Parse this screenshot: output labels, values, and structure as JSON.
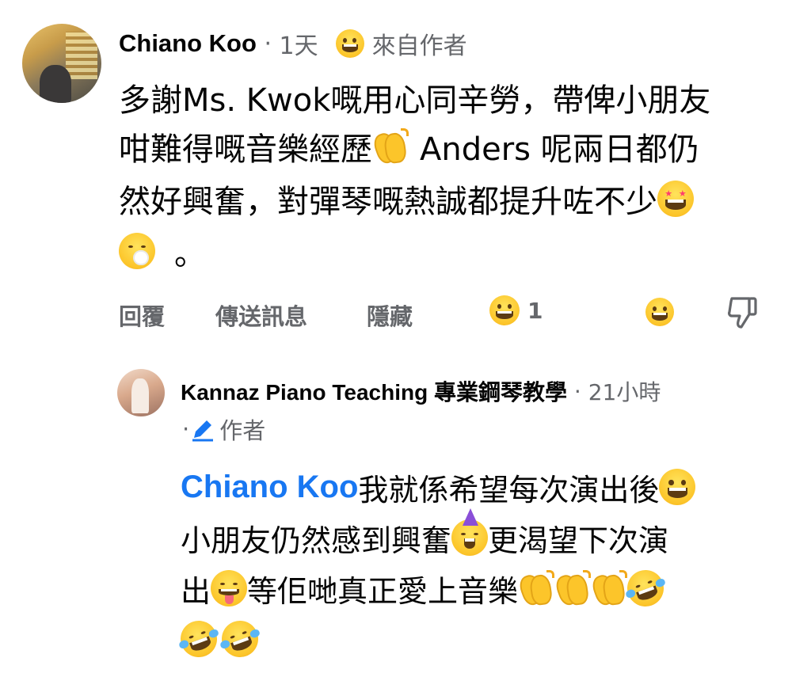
{
  "comment": {
    "author": "Chiano Koo",
    "time": "1天",
    "badge": "來自作者",
    "body_lines": [
      "多謝Ms. Kwok嘅用心同辛勞，帶俾小朋友",
      "咁難得嘅音樂經歷",
      " Anders 呢兩日都仍",
      "然好興奮，對彈琴嘅熱誠都提升咗不少",
      "。"
    ],
    "actions": {
      "reply": "回覆",
      "send_message": "傳送訊息",
      "hide": "隱藏"
    },
    "reaction_count": "1"
  },
  "reply": {
    "author": "Kannaz Piano Teaching 專業鋼琴教學",
    "time": "21小時",
    "role": "作者",
    "mention": "Chiano Koo",
    "body_lines": [
      " 我就係希望每次演出後",
      "小朋友仍然感到興奮",
      "更渴望下次演",
      "出",
      "等佢哋真正愛上音樂"
    ]
  },
  "icons": {
    "reaction": "grinning-face-icon",
    "dislike": "thumbs-down-icon",
    "pencil": "pencil-icon"
  },
  "colors": {
    "link": "#1877f2",
    "meta": "#65676b",
    "emoji": "#fcc52a"
  }
}
